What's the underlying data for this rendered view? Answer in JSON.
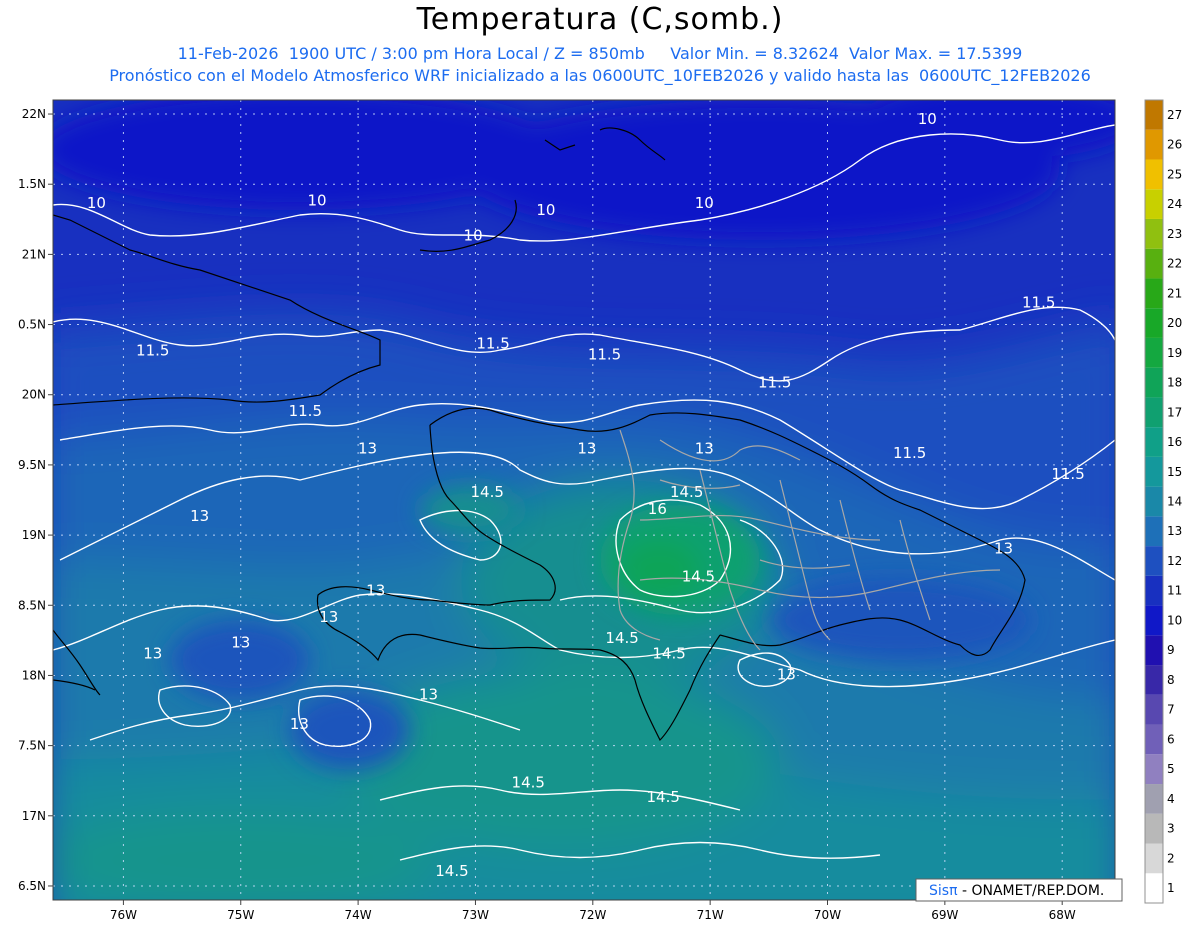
{
  "header": {
    "title": "Temperatura (C,somb.)",
    "line1": "11-Feb-2026  1900 UTC / 3:00 pm Hora Local / Z = 850mb     Valor Min. = 8.32624  Valor Max. = 17.5399",
    "line2": "Pronóstico con el Modelo Atmosferico WRF inicializado a las 0600UTC_10FEB2026 y valido hasta las  0600UTC_12FEB2026"
  },
  "axes": {
    "lon_labels": [
      "76W",
      "75W",
      "74W",
      "73W",
      "72W",
      "71W",
      "70W",
      "69W",
      "68W"
    ],
    "lat_labels": [
      "22N",
      "1.5N",
      "21N",
      "0.5N",
      "20N",
      "9.5N",
      "19N",
      "8.5N",
      "18N",
      "7.5N",
      "17N",
      "6.5N"
    ]
  },
  "contour_labels": [
    {
      "text": "10",
      "lon": -76.23,
      "lat": 21.33
    },
    {
      "text": "10",
      "lon": -74.35,
      "lat": 21.35
    },
    {
      "text": "10",
      "lon": -73.02,
      "lat": 21.1
    },
    {
      "text": "10",
      "lon": -72.4,
      "lat": 21.28
    },
    {
      "text": "10",
      "lon": -71.05,
      "lat": 21.33
    },
    {
      "text": "10",
      "lon": -69.15,
      "lat": 21.93
    },
    {
      "text": "11.5",
      "lon": -75.75,
      "lat": 20.28
    },
    {
      "text": "11.5",
      "lon": -72.85,
      "lat": 20.33
    },
    {
      "text": "11.5",
      "lon": -71.9,
      "lat": 20.25
    },
    {
      "text": "11.5",
      "lon": -70.45,
      "lat": 20.05
    },
    {
      "text": "11.5",
      "lon": -74.45,
      "lat": 19.85
    },
    {
      "text": "11.5",
      "lon": -68.2,
      "lat": 20.62
    },
    {
      "text": "11.5",
      "lon": -69.3,
      "lat": 19.55
    },
    {
      "text": "11.5",
      "lon": -67.95,
      "lat": 19.4
    },
    {
      "text": "13",
      "lon": -73.92,
      "lat": 19.58
    },
    {
      "text": "13",
      "lon": -72.05,
      "lat": 19.58
    },
    {
      "text": "13",
      "lon": -71.05,
      "lat": 19.58
    },
    {
      "text": "13",
      "lon": -75.35,
      "lat": 19.1
    },
    {
      "text": "13",
      "lon": -68.5,
      "lat": 18.87
    },
    {
      "text": "13",
      "lon": -73.85,
      "lat": 18.57
    },
    {
      "text": "13",
      "lon": -74.25,
      "lat": 18.38
    },
    {
      "text": "13",
      "lon": -75.0,
      "lat": 18.2
    },
    {
      "text": "13",
      "lon": -75.75,
      "lat": 18.12
    },
    {
      "text": "13",
      "lon": -70.35,
      "lat": 17.97
    },
    {
      "text": "13",
      "lon": -73.4,
      "lat": 17.83
    },
    {
      "text": "13",
      "lon": -74.5,
      "lat": 17.62
    },
    {
      "text": "14.5",
      "lon": -72.9,
      "lat": 19.27
    },
    {
      "text": "14.5",
      "lon": -71.2,
      "lat": 19.27
    },
    {
      "text": "16",
      "lon": -71.45,
      "lat": 19.15
    },
    {
      "text": "14.5",
      "lon": -71.1,
      "lat": 18.67
    },
    {
      "text": "14.5",
      "lon": -71.75,
      "lat": 18.23
    },
    {
      "text": "14.5",
      "lon": -71.35,
      "lat": 18.12
    },
    {
      "text": "14.5",
      "lon": -72.55,
      "lat": 17.2
    },
    {
      "text": "14.5",
      "lon": -71.4,
      "lat": 17.1
    },
    {
      "text": "14.5",
      "lon": -73.2,
      "lat": 16.57
    }
  ],
  "colorbar": {
    "labels": [
      "1",
      "2",
      "3",
      "4",
      "5",
      "6",
      "7",
      "8",
      "9",
      "10",
      "11",
      "12",
      "13",
      "14",
      "15",
      "16",
      "17",
      "18",
      "19",
      "20",
      "21",
      "22",
      "23",
      "24",
      "25",
      "26",
      "27"
    ],
    "colors": [
      "#ffffff",
      "#d8d8d8",
      "#b8b8b8",
      "#a0a0b0",
      "#9080c0",
      "#7060b8",
      "#5848b0",
      "#3828a8",
      "#2010b0",
      "#1018c8",
      "#1830c0",
      "#1e50c0",
      "#1e70b8",
      "#1a88a8",
      "#14989c",
      "#10a088",
      "#10a070",
      "#10a458",
      "#14a840",
      "#18a828",
      "#28a818",
      "#58b010",
      "#90c010",
      "#c8d000",
      "#f0c000",
      "#e09800",
      "#c07800"
    ]
  },
  "credit": {
    "sis": "Sis",
    "pi": "π",
    "rest": " - ONAMET/REP.DOM."
  }
}
